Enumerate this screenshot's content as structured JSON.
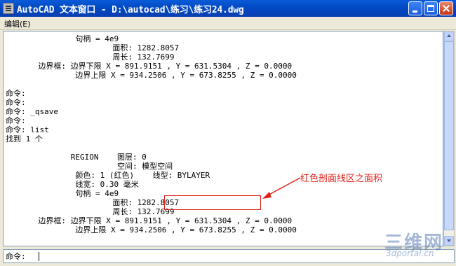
{
  "window": {
    "title": "AutoCAD 文本窗口 - D:\\autocad\\练习\\练习24.dwg",
    "buttons": {
      "minimize": "",
      "maximize": "",
      "close": ""
    }
  },
  "menu": {
    "items": [
      "编辑(E)"
    ]
  },
  "text_lines": [
    "               句柄 = 4e9",
    "                       面积: 1282.8057",
    "                       周长: 132.7699",
    "       边界框: 边界下限 X = 891.9151 , Y = 631.5304 , Z = 0.0000",
    "               边界上限 X = 934.2506 , Y = 673.8255 , Z = 0.0000",
    "",
    "命令:",
    "命令:",
    "命令: _qsave",
    "命令:",
    "命令: list",
    "找到 1 个",
    "",
    "              REGION    图层: 0",
    "                        空间: 模型空间",
    "               颜色: 1 (红色)    线型: BYLAYER",
    "               线宽: 0.30 毫米",
    "               句柄 = 4e9",
    "                       面积: 1282.8057",
    "                       周长: 132.7699",
    "       边界框: 边界下限 X = 891.9151 , Y = 631.5304 , Z = 0.0000",
    "               边界上限 X = 934.2506 , Y = 673.8255 , Z = 0.0000"
  ],
  "command_line": {
    "prompt": "命令:"
  },
  "annotation": {
    "text": "红色剖面线区之面积",
    "color": "#e0221b"
  },
  "watermark": {
    "main": "三维网",
    "sub": "3dportal.cn"
  },
  "colors": {
    "titlebar": "#0049c3",
    "annotation": "#e0221b",
    "text": "#000000"
  }
}
